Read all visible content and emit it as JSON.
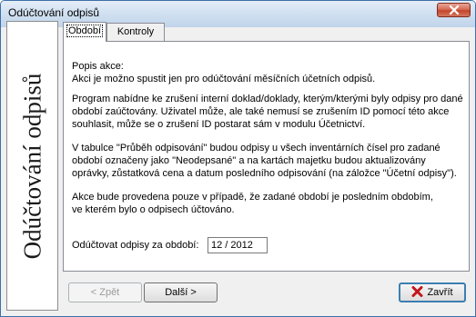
{
  "window": {
    "title": "Odúčtování odpisů",
    "side_title": "Odúčtování odpisů"
  },
  "tabs": [
    {
      "label": "Období",
      "active": true
    },
    {
      "label": "Kontroly",
      "active": false
    }
  ],
  "content": {
    "p1_line1": "Popis akce:",
    "p1_line2": "Akci je možno spustit jen pro odúčtování měsíčních účetních odpisů.",
    "p2_line1": "Program nabídne ke zrušení interní doklad/doklady, kterým/kterými byly odpisy pro dané",
    "p2_line2": "období zaúčtovány. Uživatel může, ale také nemusí se zrušením ID pomocí této akce",
    "p2_line3": "souhlasit, může se o zrušení ID postarat sám v modulu Účetnictví.",
    "p3_line1": "V tabulce \"Průběh odpisování\" budou odpisy u všech inventárních čísel pro zadané",
    "p3_line2": "období označeny jako \"Neodepsané\" a na kartách majetku budou aktualizovány",
    "p3_line3": "oprávky, zůstatková cena a datum posledního odpisování (na záložce \"Účetní odpisy\").",
    "p4_line1": "Akce bude provedena pouze v případě, že zadané období je posledním obdobím,",
    "p4_line2": "ve kterém bylo o odpisech účtováno.",
    "period_label": "Odúčtovat odpisy za období:",
    "period_value": "12 / 2012"
  },
  "buttons": {
    "back": "< Zpět",
    "next": "Další >",
    "close": "Zavřít"
  },
  "colors": {
    "close_icon": "#c4161c",
    "titlebar": "#d2e1f1"
  }
}
